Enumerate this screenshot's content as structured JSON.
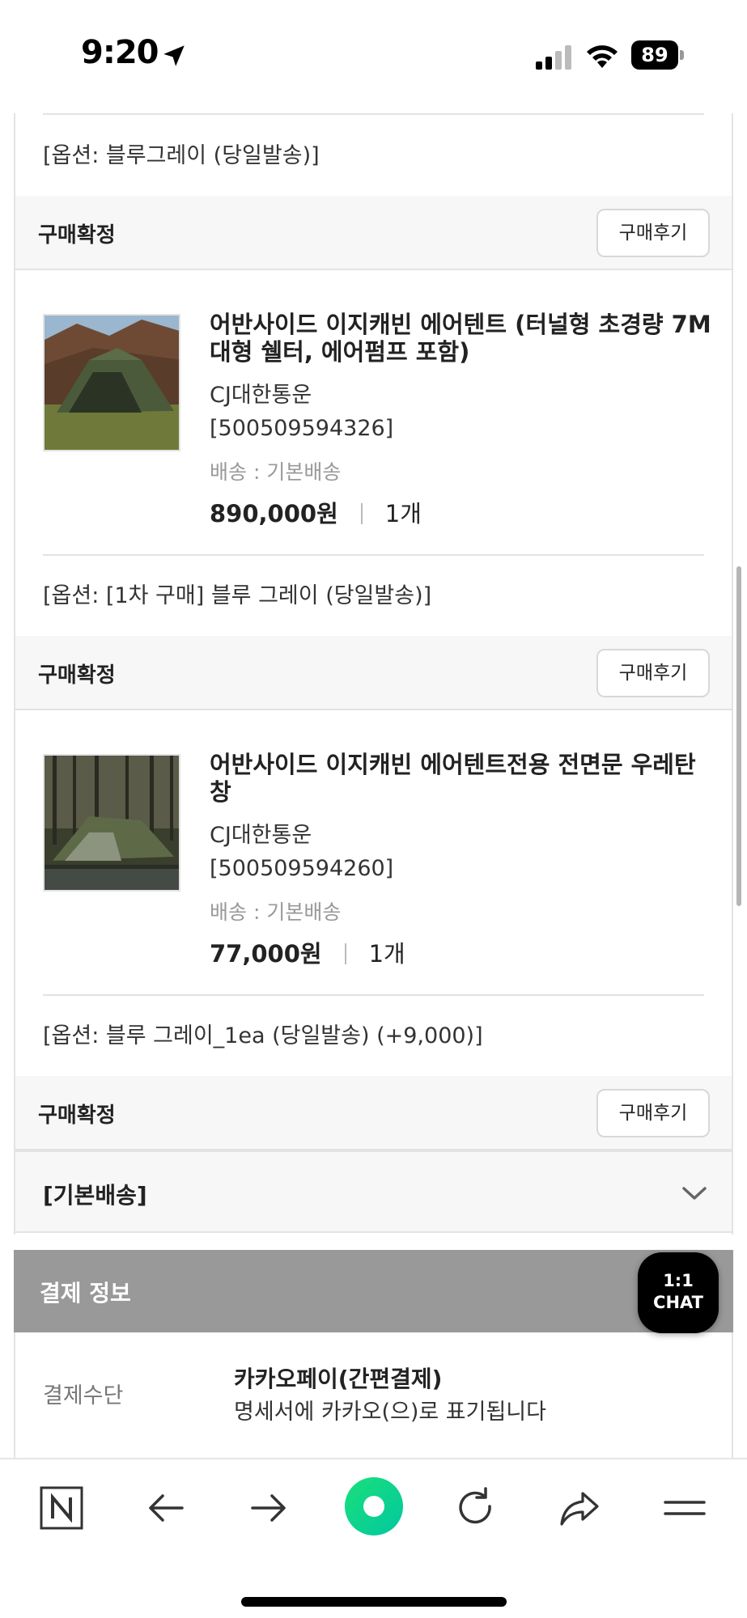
{
  "status_bar": {
    "time": "9:20",
    "battery": "89"
  },
  "groups": [
    {
      "option": "[옵션: 블루그레이 (당일발송)]",
      "status": "구매확정",
      "review_label": "구매후기"
    },
    {
      "product": {
        "name": "어반사이드 이지캐빈 에어텐트 (터널형 초경량 7M 대형 쉘터, 에어펌프 포함)",
        "carrier": "CJ대한통운",
        "tracking": "[500509594326]",
        "shipping": "배송 : 기본배송",
        "price": "890,000원",
        "quantity": "1개"
      },
      "option": "[옵션: [1차 구매] 블루 그레이 (당일발송)]",
      "status": "구매확정",
      "review_label": "구매후기"
    },
    {
      "product": {
        "name": "어반사이드 이지캐빈 에어텐트전용 전면문 우레탄 창",
        "carrier": "CJ대한통운",
        "tracking": "[500509594260]",
        "shipping": "배송 : 기본배송",
        "price": "77,000원",
        "quantity": "1개"
      },
      "option": "[옵션: 블루 그레이_1ea (당일발송) (+9,000)]",
      "status": "구매확정",
      "review_label": "구매후기"
    }
  ],
  "basic_shipping": {
    "label": "[기본배송]",
    "icon": "chevron-down-icon"
  },
  "payment": {
    "title": "결제 정보",
    "method_label": "결제수단",
    "method": "카카오페이(간편결제)",
    "note": "명세서에 카카오(으)로 표기됩니다"
  },
  "chat": {
    "line1": "1:1",
    "line2": "CHAT"
  },
  "toolbar": {
    "items": [
      "naver-n-icon",
      "back-arrow-icon",
      "forward-arrow-icon",
      "green-dot-icon",
      "reload-icon",
      "share-icon",
      "menu-icon"
    ]
  },
  "colors": {
    "accent_green": "#03c75a",
    "payment_header": "#999999",
    "confirm_bar": "#f7f7f7"
  }
}
